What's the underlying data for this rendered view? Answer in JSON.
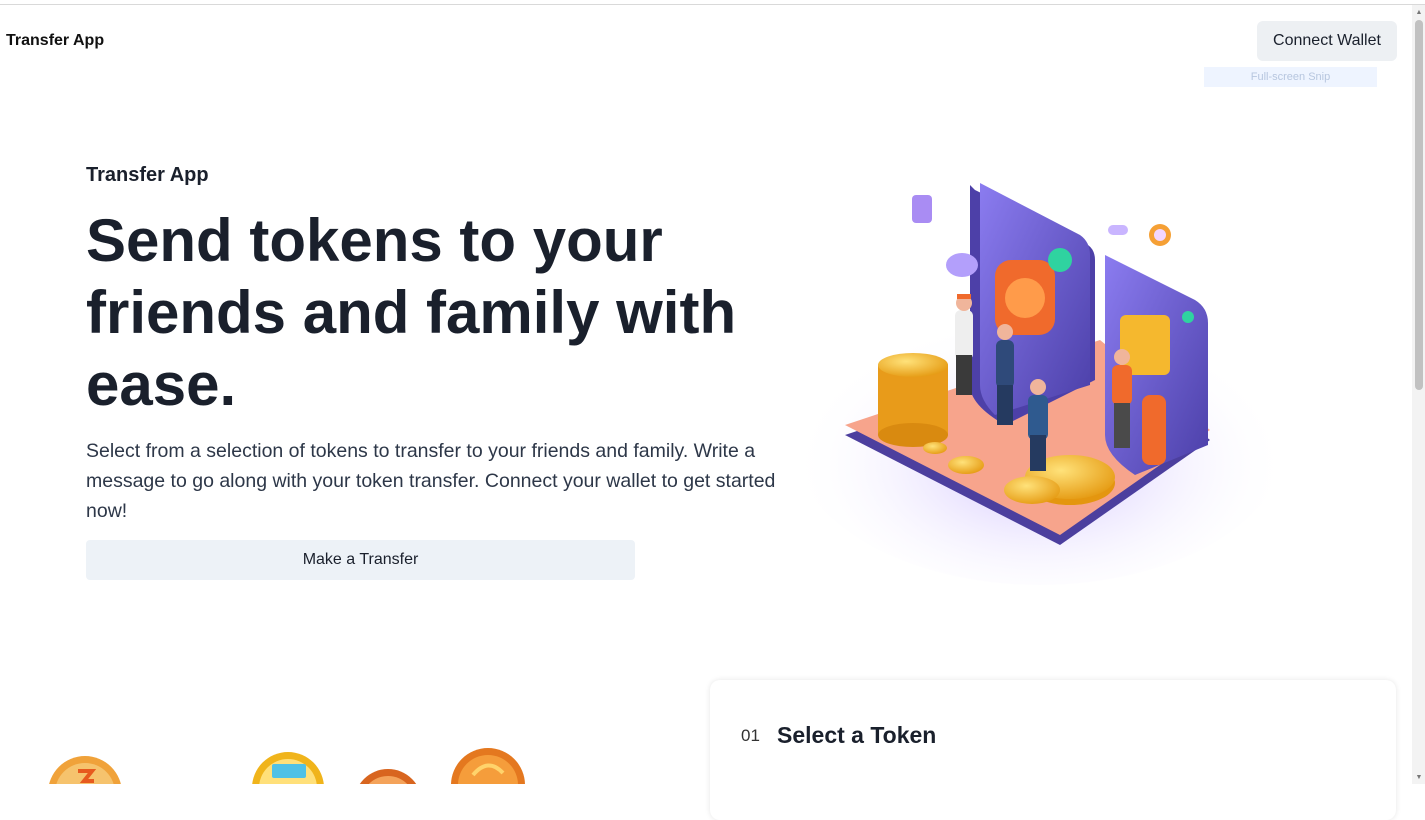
{
  "navbar": {
    "brand": "Transfer App",
    "connect_wallet_label": "Connect Wallet"
  },
  "overlay": {
    "snip_label": "Full-screen Snip"
  },
  "hero": {
    "eyebrow": "Transfer App",
    "title": "Send tokens to your friends and family with ease.",
    "description": "Select from a selection of tokens to transfer to your friends and family. Write a message to go along with your token transfer. Connect your wallet to get started now!",
    "cta_label": "Make a Transfer",
    "illustration_icon": "token-transfer-illustration"
  },
  "steps": [
    {
      "number": "01",
      "title": "Select a Token"
    }
  ],
  "decorative_tokens": [
    "lightning-coin-icon",
    "ticket-coin-icon",
    "copper-coin-icon",
    "flame-coin-icon"
  ],
  "colors": {
    "primary_text": "#1a202c",
    "button_bg": "#edf2f7",
    "illustration_purple": "#6b5fd0",
    "illustration_peach": "#f7a48c",
    "coin_gold": "#f5b82e",
    "accent_orange": "#f06a2c"
  }
}
